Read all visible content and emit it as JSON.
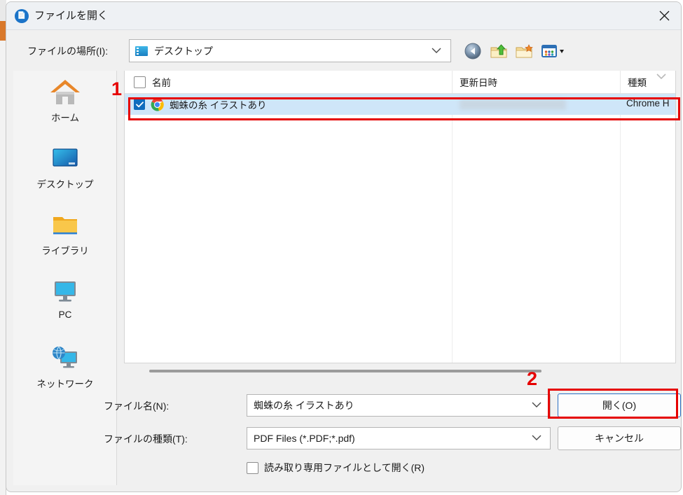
{
  "window": {
    "title": "ファイルを開く",
    "app_icon": "pdf-app-icon",
    "close_label": "×"
  },
  "location": {
    "label": "ファイルの場所(I):",
    "value": "デスクトップ",
    "icon": "desktop-icon",
    "chevron": "chevron-down-icon"
  },
  "toolbar": {
    "buttons": [
      {
        "name": "back-button",
        "icon": "back-arrow-icon"
      },
      {
        "name": "up-folder-button",
        "icon": "up-folder-icon"
      },
      {
        "name": "new-folder-button",
        "icon": "new-folder-icon"
      },
      {
        "name": "views-button",
        "icon": "views-grid-icon"
      }
    ]
  },
  "places": {
    "items": [
      {
        "label": "ホーム",
        "icon": "home-icon"
      },
      {
        "label": "デスクトップ",
        "icon": "desktop-monitor-icon"
      },
      {
        "label": "ライブラリ",
        "icon": "folder-icon"
      },
      {
        "label": "PC",
        "icon": "pc-monitor-icon"
      },
      {
        "label": "ネットワーク",
        "icon": "network-globe-icon"
      }
    ]
  },
  "file_list": {
    "columns": [
      "名前",
      "更新日時",
      "種類"
    ],
    "sort_indicator": "chevron-down-icon",
    "header_checkbox_checked": false,
    "rows": [
      {
        "checked": true,
        "icon": "chrome-icon",
        "name": "蜘蛛の糸 イラストあり",
        "date_modified": "",
        "type": "Chrome H",
        "selected": true
      }
    ]
  },
  "form": {
    "filename_label": "ファイル名(N):",
    "filename_value": "蜘蛛の糸 イラストあり",
    "filetype_label": "ファイルの種類(T):",
    "filetype_value": "PDF Files (*.PDF;*.pdf)",
    "readonly_label": "読み取り専用ファイルとして開く(R)",
    "readonly_checked": false
  },
  "buttons": {
    "open": "開く(O)",
    "cancel": "キャンセル"
  },
  "annotations": {
    "marker_1": "1",
    "marker_2": "2",
    "color": "#e60000"
  }
}
